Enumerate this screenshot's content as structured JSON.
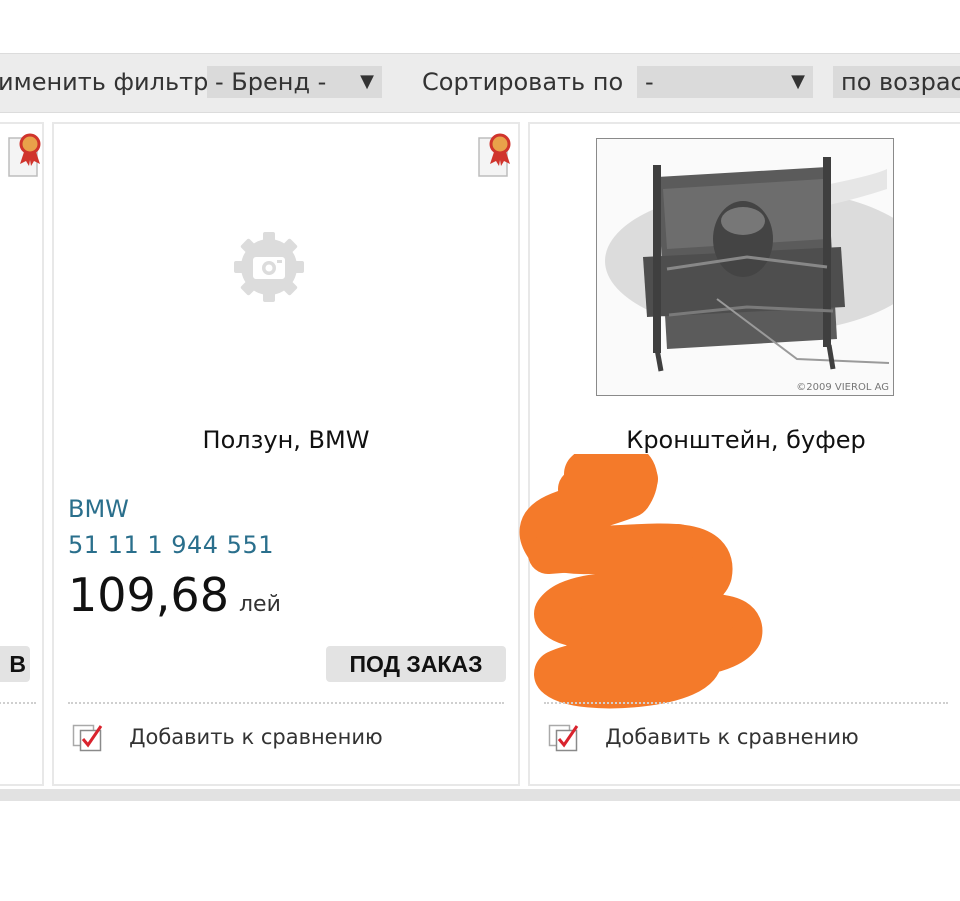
{
  "filter_bar": {
    "apply_filter_text": "именить фильтр",
    "brand_select_value": "- Бренд -",
    "sort_label": "Сортировать по",
    "sort_select_value": "-",
    "order_select_value": "по возрас"
  },
  "cards": [
    {
      "order_button": "В",
      "icons": [
        "certificate-icon"
      ]
    },
    {
      "title": "Ползун, BMW",
      "brand": "BMW",
      "part_number": "51 11 1 944 551",
      "price": "109,68",
      "currency": "лей",
      "order_button": "ПОД ЗАКАЗ",
      "compare_label": "Добавить к сравнению",
      "icons": [
        "certificate-icon",
        "image-placeholder-icon",
        "compare-checkbox-icon"
      ]
    },
    {
      "title": "Кронштейн, буфер",
      "photo_credit": "©2009 VIEROL AG",
      "compare_label": "Добавить к сравнению",
      "icons": [
        "compare-checkbox-icon"
      ]
    }
  ],
  "colors": {
    "link": "#2a6f8c",
    "redaction": "#f47a2a",
    "compare_check": "#d9232d"
  }
}
